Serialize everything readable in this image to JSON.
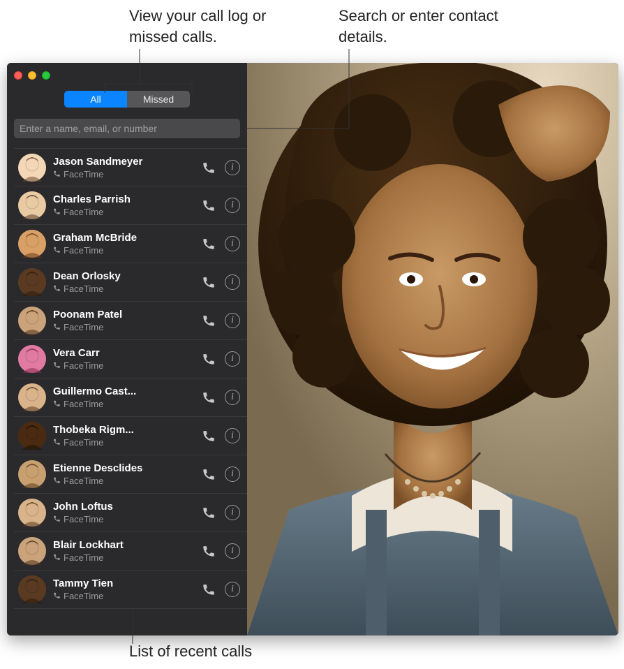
{
  "callouts": {
    "top_left": "View your call log or missed calls.",
    "top_right": "Search or enter contact details.",
    "bottom": "List of recent calls"
  },
  "tabs": {
    "all": "All",
    "missed": "Missed",
    "active": "all"
  },
  "search": {
    "placeholder": "Enter a name, email, or number",
    "value": ""
  },
  "sublabel": "FaceTime",
  "avatar_colors": [
    [
      "#f3d7b6",
      "#6b4a30"
    ],
    [
      "#e9caa3",
      "#5a3e28"
    ],
    [
      "#d9a066",
      "#6b3a1a"
    ],
    [
      "#5a3a20",
      "#2a1a0e"
    ],
    [
      "#caa37a",
      "#4a2f18"
    ],
    [
      "#e07aa0",
      "#8a2a50"
    ],
    [
      "#d9b38a",
      "#5a3a20"
    ],
    [
      "#4a2a10",
      "#1a0e05"
    ],
    [
      "#c8a070",
      "#5a3a20"
    ],
    [
      "#d9b38a",
      "#5a3a20"
    ],
    [
      "#caa37a",
      "#4a2f18"
    ],
    [
      "#5a3a20",
      "#2a1a0e"
    ]
  ],
  "recents": [
    {
      "name": "Jason Sandmeyer"
    },
    {
      "name": "Charles Parrish"
    },
    {
      "name": "Graham McBride"
    },
    {
      "name": "Dean Orlosky"
    },
    {
      "name": "Poonam Patel"
    },
    {
      "name": "Vera Carr"
    },
    {
      "name": "Guillermo Cast..."
    },
    {
      "name": "Thobeka Rigm..."
    },
    {
      "name": "Etienne Desclides"
    },
    {
      "name": "John Loftus"
    },
    {
      "name": "Blair Lockhart"
    },
    {
      "name": "Tammy Tien"
    }
  ]
}
